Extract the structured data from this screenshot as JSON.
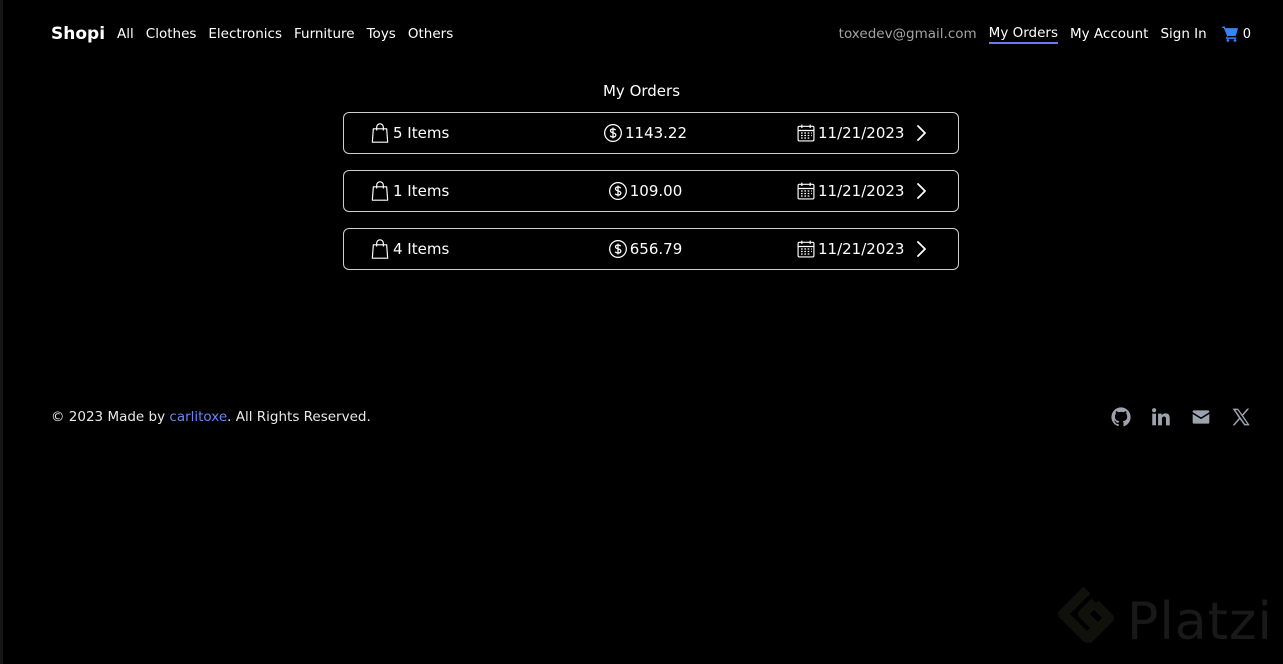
{
  "nav": {
    "brand": "Shopi",
    "categories": [
      "All",
      "Clothes",
      "Electronics",
      "Furniture",
      "Toys",
      "Others"
    ],
    "email": "toxedev@gmail.com",
    "my_orders": "My Orders",
    "my_account": "My Account",
    "sign_in": "Sign In",
    "cart_count": "0"
  },
  "page": {
    "title": "My Orders"
  },
  "orders": [
    {
      "items": "5 Items",
      "price": "1143.22",
      "date": "11/21/2023"
    },
    {
      "items": "1 Items",
      "price": "109.00",
      "date": "11/21/2023"
    },
    {
      "items": "4 Items",
      "price": "656.79",
      "date": "11/21/2023"
    }
  ],
  "footer": {
    "copyright_prefix": "© 2023 Made by ",
    "author": "carlitoxe",
    "copyright_suffix": ". All Rights Reserved.",
    "socials": [
      "github-icon",
      "linkedin-icon",
      "mail-icon",
      "x-icon"
    ]
  },
  "watermark": {
    "text": "Platzi"
  },
  "colors": {
    "accent": "#6b7cf0",
    "link": "#6b86f0",
    "background": "#000000",
    "cart": "#3b82f6"
  }
}
